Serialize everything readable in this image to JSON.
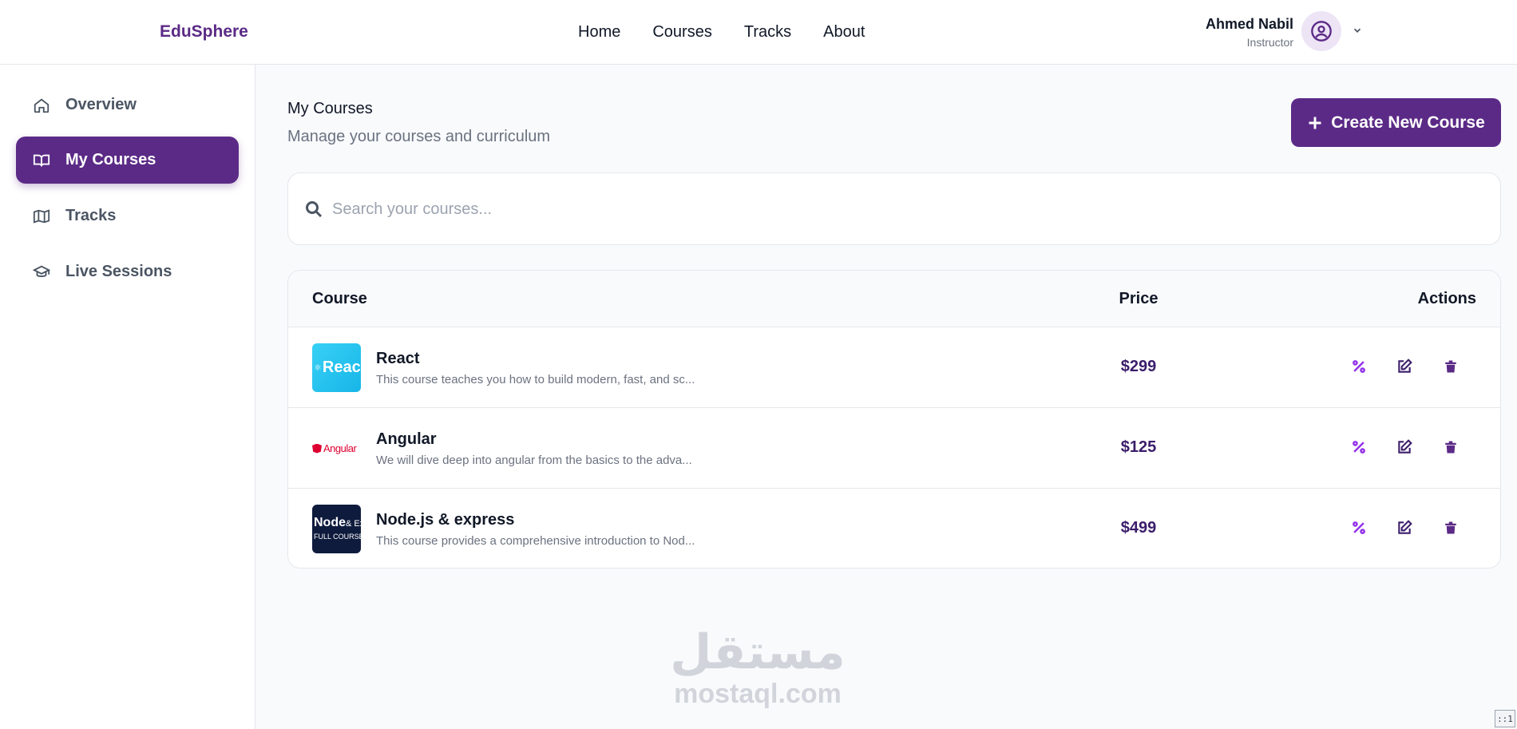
{
  "brand": "EduSphere",
  "nav": [
    "Home",
    "Courses",
    "Tracks",
    "About"
  ],
  "user": {
    "name": "Ahmed Nabil",
    "role": "Instructor"
  },
  "sidebar": {
    "items": [
      {
        "label": "Overview",
        "icon": "home-icon"
      },
      {
        "label": "My Courses",
        "icon": "book-open-icon",
        "active": true
      },
      {
        "label": "Tracks",
        "icon": "map-icon"
      },
      {
        "label": "Live Sessions",
        "icon": "graduation-cap-icon"
      }
    ]
  },
  "main": {
    "title": "My Courses",
    "subtitle": "Manage your courses and curriculum",
    "create_label": "Create New Course",
    "search": {
      "placeholder": "Search your courses...",
      "value": ""
    }
  },
  "table": {
    "headers": {
      "course": "Course",
      "price": "Price",
      "actions": "Actions"
    },
    "rows": [
      {
        "name": "React",
        "thumb_text": "React",
        "description": "This course teaches you how to build modern, fast, and sc...",
        "price": "$299"
      },
      {
        "name": "Angular",
        "thumb_text": "Angular",
        "description": "We will dive deep into angular from the basics to the adva...",
        "price": "$125"
      },
      {
        "name": "Node.js & express",
        "thumb_text": "Node & Express FULL COURSE",
        "thumb_line1": "Node",
        "thumb_line2": "& Express",
        "thumb_line3": "FULL COURSE",
        "description": "This course provides a comprehensive introduction to Nod...",
        "price": "$499"
      }
    ]
  },
  "watermark": {
    "arabic": "مستقل",
    "latin": "mostaql.com"
  },
  "corner_label": "::1",
  "colors": {
    "accent": "#5b2a86",
    "discount": "#9333ea",
    "text_muted": "#6b7280"
  }
}
